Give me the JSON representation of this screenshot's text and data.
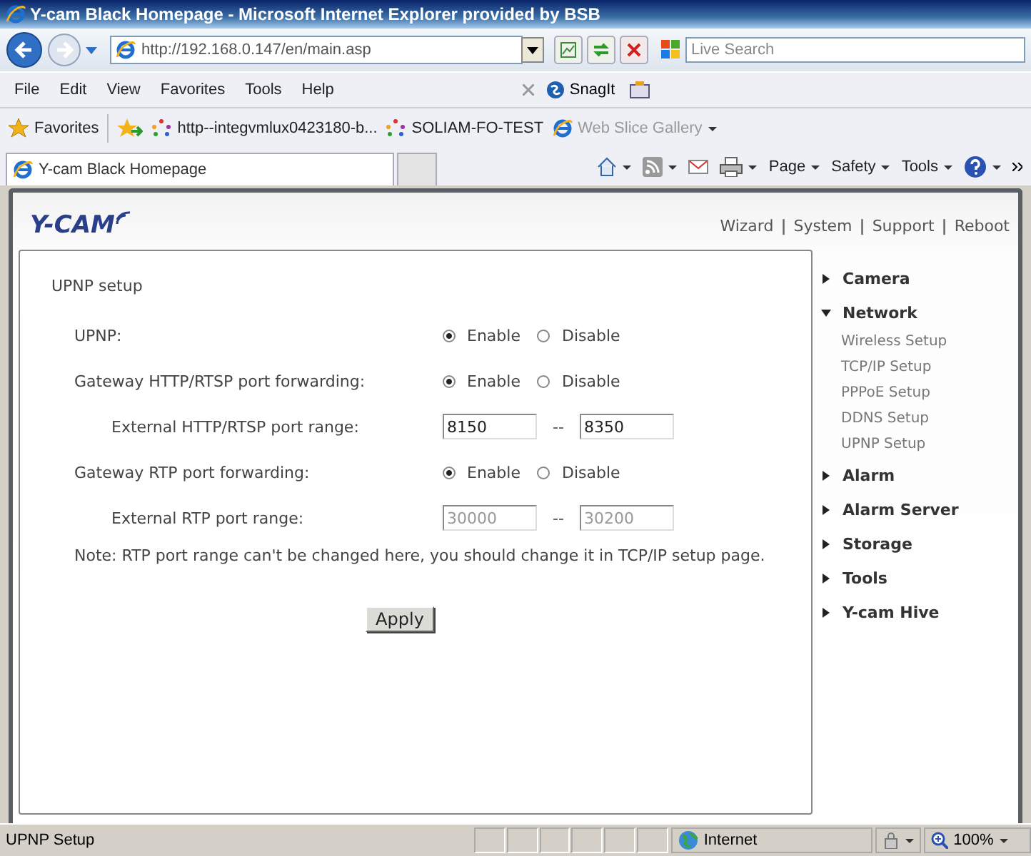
{
  "window": {
    "title": "Y-cam Black Homepage - Microsoft Internet Explorer provided by BSB"
  },
  "address_bar": {
    "url": "http://192.168.0.147/en/main.asp"
  },
  "search": {
    "placeholder": "Live Search"
  },
  "menu": [
    "File",
    "Edit",
    "View",
    "Favorites",
    "Tools",
    "Help"
  ],
  "menu_tools": [
    {
      "label": "SnagIt"
    }
  ],
  "favorites_bar": {
    "label": "Favorites",
    "links": [
      {
        "label": "http--integvmlux0423180-b...",
        "disabled": false,
        "kind": "dots"
      },
      {
        "label": "SOLIAM-FO-TEST",
        "disabled": false,
        "kind": "dots"
      },
      {
        "label": "Web Slice Gallery",
        "disabled": true,
        "kind": "ie"
      }
    ]
  },
  "tabs": [
    {
      "label": "Y-cam Black Homepage",
      "selected": true
    }
  ],
  "command_buttons": [
    "Page",
    "Safety",
    "Tools"
  ],
  "page": {
    "logo": "Y-CAM",
    "top_links": [
      {
        "kind": "link",
        "label": "Wizard"
      },
      {
        "kind": "separator",
        "label": "|"
      },
      {
        "kind": "link",
        "label": "System"
      },
      {
        "kind": "separator",
        "label": "|"
      },
      {
        "kind": "link",
        "label": "Support"
      },
      {
        "kind": "separator",
        "label": "|"
      },
      {
        "kind": "link",
        "label": "Reboot"
      }
    ],
    "section_title": "UPNP setup",
    "rows": [
      {
        "kind": "radio",
        "label": "UPNP:",
        "options": [
          {
            "label": "Enable",
            "selected": true
          },
          {
            "label": "Disable",
            "selected": false
          }
        ]
      },
      {
        "kind": "radio",
        "label": "Gateway HTTP/RTSP port forwarding:",
        "options": [
          {
            "label": "Enable",
            "selected": true
          },
          {
            "label": "Disable",
            "selected": false
          }
        ]
      },
      {
        "kind": "range",
        "label": "External HTTP/RTSP port range:",
        "from": "8150",
        "separator": "--",
        "to": "8350",
        "disabled": false
      },
      {
        "kind": "radio",
        "label": "Gateway RTP port forwarding:",
        "options": [
          {
            "label": "Enable",
            "selected": true
          },
          {
            "label": "Disable",
            "selected": false
          }
        ]
      },
      {
        "kind": "range",
        "label": "External RTP port range:",
        "from": "30000",
        "separator": "--",
        "to": "30200",
        "disabled": true
      }
    ],
    "note": "Note: RTP port range can't be changed here, you should change it in TCP/IP setup page.",
    "apply": "Apply"
  },
  "sidebar": [
    {
      "label": "Camera",
      "expanded": false
    },
    {
      "label": "Network",
      "expanded": true,
      "children": [
        {
          "label": "Wireless Setup"
        },
        {
          "label": "TCP/IP Setup"
        },
        {
          "label": "PPPoE Setup"
        },
        {
          "label": "DDNS Setup"
        },
        {
          "label": "UPNP Setup"
        }
      ]
    },
    {
      "label": "Alarm",
      "expanded": false
    },
    {
      "label": "Alarm Server",
      "expanded": false
    },
    {
      "label": "Storage",
      "expanded": false
    },
    {
      "label": "Tools",
      "expanded": false
    },
    {
      "label": "Y-cam Hive",
      "expanded": false
    }
  ],
  "status_bar": {
    "text": "UPNP Setup",
    "zone": "Internet",
    "zoom": "100%"
  }
}
